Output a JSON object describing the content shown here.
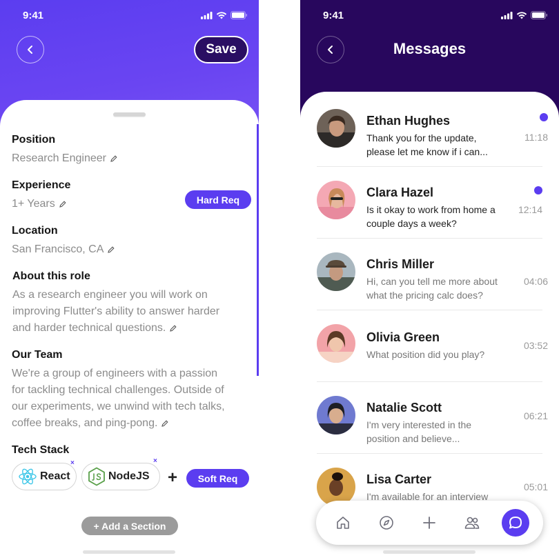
{
  "left_screen": {
    "status": {
      "time": "9:41"
    },
    "header": {
      "save_label": "Save"
    },
    "fields": {
      "position": {
        "label": "Position",
        "value": "Research Engineer"
      },
      "experience": {
        "label": "Experience",
        "value": "1+ Years",
        "badge": "Hard Req"
      },
      "location": {
        "label": "Location",
        "value": "San Francisco, CA"
      },
      "about": {
        "label": "About this role",
        "line1": "As a research engineer you will work on",
        "line2": "improving Flutter's ability to answer harder",
        "line3": "and harder technical questions."
      },
      "team": {
        "label": "Our Team",
        "line1": "We're a group of engineers with a passion",
        "line2": "for tackling technical challenges. Outside of",
        "line3": "our experiments, we unwind with tech talks,",
        "line4": "coffee breaks, and ping-pong."
      },
      "tech": {
        "label": "Tech Stack",
        "chips": [
          "React",
          "NodeJS"
        ],
        "remove_glyph": "×",
        "add_glyph": "+",
        "badge": "Soft Req"
      }
    },
    "add_section_label": "+ Add a Section",
    "colors": {
      "accent": "#5b3df0",
      "save_bg": "#2a0e63"
    }
  },
  "right_screen": {
    "status": {
      "time": "9:41"
    },
    "title": "Messages",
    "conversations": [
      {
        "name": "Ethan Hughes",
        "line1": "Thank you for the update,",
        "line2": "please let me know if i can...",
        "time": "11:18",
        "unread": true
      },
      {
        "name": "Clara Hazel",
        "line1": "Is it okay to work from home a",
        "line2": "couple days a week?",
        "time": "12:14",
        "unread": true
      },
      {
        "name": "Chris Miller",
        "line1": "Hi, can you tell me more about",
        "line2": "what the pricing calc does?",
        "time": "04:06",
        "unread": false
      },
      {
        "name": "Olivia Green",
        "line1": "What position did you play?",
        "line2": "",
        "time": "03:52",
        "unread": false
      },
      {
        "name": "Natalie Scott",
        "line1": "I'm very interested in the",
        "line2": "position and believe...",
        "time": "06:21",
        "unread": false
      },
      {
        "name": "Lisa Carter",
        "line1": "I'm available for an interview",
        "line2": "",
        "time": "05:01",
        "unread": false
      }
    ],
    "tabbar": [
      "home-icon",
      "compass-icon",
      "plus-icon",
      "people-icon",
      "chat-icon"
    ],
    "colors": {
      "header_bg": "#28075d",
      "accent": "#5b3df0"
    }
  }
}
